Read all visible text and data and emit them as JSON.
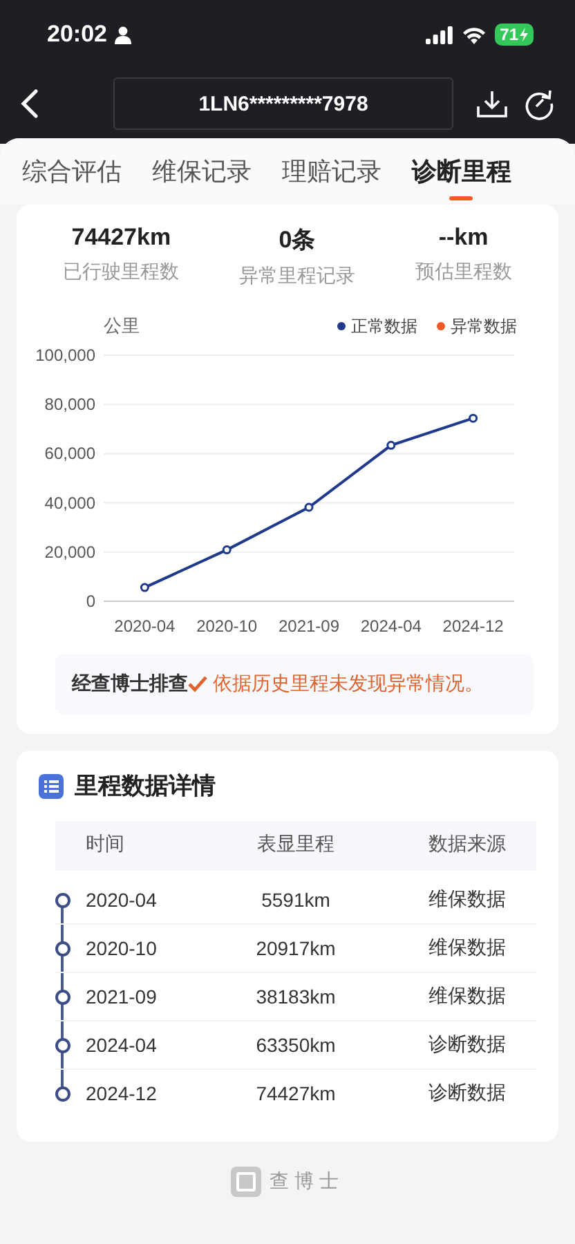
{
  "status_bar": {
    "time": "20:02",
    "battery": "71"
  },
  "header": {
    "vin": "1LN6*********7978"
  },
  "tabs": [
    {
      "label": "综合评估",
      "selected": false
    },
    {
      "label": "维保记录",
      "selected": false
    },
    {
      "label": "理赔记录",
      "selected": false
    },
    {
      "label": "诊断里程",
      "selected": true
    }
  ],
  "stats": [
    {
      "value": "74427km",
      "label": "已行驶里程数"
    },
    {
      "value": "0条",
      "label": "异常里程记录"
    },
    {
      "value": "--km",
      "label": "预估里程数"
    }
  ],
  "chart": {
    "unit": "公里",
    "chart_data": {
      "type": "line",
      "categories": [
        "2020-04",
        "2020-10",
        "2021-09",
        "2024-04",
        "2024-12"
      ],
      "grid": true,
      "series": [
        {
          "name": "正常数据",
          "color": "#1f3a8a",
          "marker": "circle",
          "values": [
            5600,
            20900,
            38200,
            63400,
            74400
          ]
        },
        {
          "name": "异常数据",
          "color": "#f05a28",
          "values": [
            null,
            null,
            null,
            null,
            null
          ]
        }
      ],
      "ylim": [
        0,
        100000
      ],
      "yticks": [
        {
          "value": 0,
          "label": "0"
        },
        {
          "value": 20000,
          "label": "20,000"
        },
        {
          "value": 40000,
          "label": "40,000"
        },
        {
          "value": 60000,
          "label": "60,000"
        },
        {
          "value": 80000,
          "label": "80,000"
        },
        {
          "value": 100000,
          "label": "100,000"
        }
      ]
    }
  },
  "note": {
    "lead": "经查博士排查",
    "text": "依据历史里程未发现异常情况。"
  },
  "details": {
    "title": "里程数据详情",
    "columns": [
      "时间",
      "表显里程",
      "数据来源"
    ],
    "rows": [
      {
        "time": "2020-04",
        "mileage": "5591km",
        "source": "维保数据"
      },
      {
        "time": "2020-10",
        "mileage": "20917km",
        "source": "维保数据"
      },
      {
        "time": "2021-09",
        "mileage": "38183km",
        "source": "维保数据"
      },
      {
        "time": "2024-04",
        "mileage": "63350km",
        "source": "诊断数据"
      },
      {
        "time": "2024-12",
        "mileage": "74427km",
        "source": "诊断数据"
      }
    ]
  },
  "footer": {
    "brand": "查博士"
  }
}
